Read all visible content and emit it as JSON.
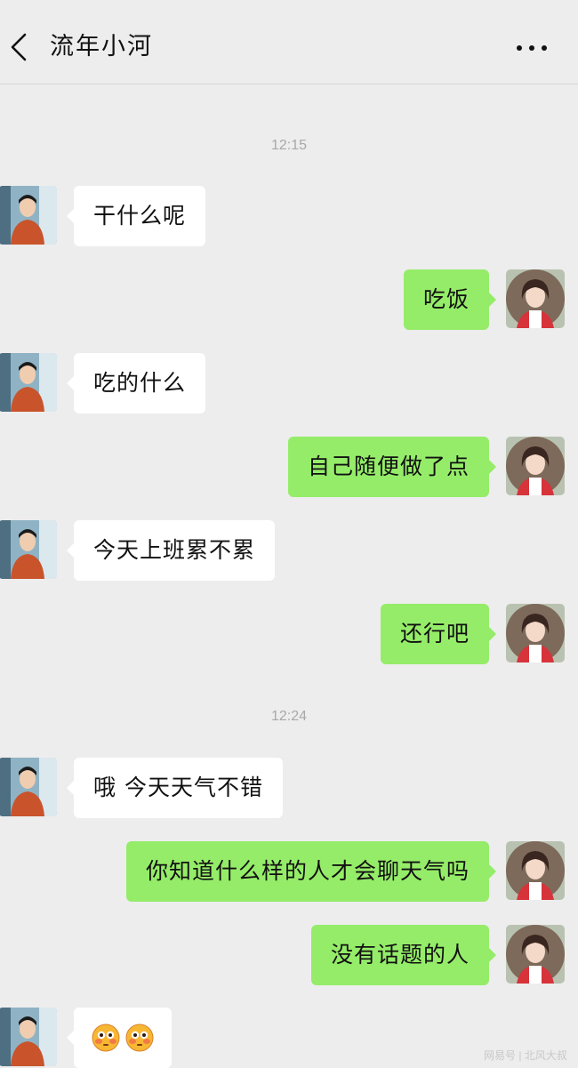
{
  "header": {
    "title": "流年小河",
    "back_icon": "chevron-left-icon",
    "more_icon": "more-dots-icon"
  },
  "timestamps": [
    "12:15",
    "12:24"
  ],
  "messages": [
    {
      "side": "left",
      "text": "干什么呢"
    },
    {
      "side": "right",
      "text": "吃饭"
    },
    {
      "side": "left",
      "text": "吃的什么"
    },
    {
      "side": "right",
      "text": "自己随便做了点"
    },
    {
      "side": "left",
      "text": "今天上班累不累"
    },
    {
      "side": "right",
      "text": "还行吧"
    },
    {
      "side": "left",
      "text": "哦 今天天气不错"
    },
    {
      "side": "right",
      "text": "你知道什么样的人才会聊天气吗"
    },
    {
      "side": "right",
      "text": "没有话题的人"
    },
    {
      "side": "left",
      "emojis": [
        "flushed-face-emoji",
        "flushed-face-emoji"
      ]
    }
  ],
  "watermark": "网易号 | 北风大叔",
  "colors": {
    "background": "#ededed",
    "sent_bubble": "#95ec69",
    "received_bubble": "#ffffff"
  }
}
